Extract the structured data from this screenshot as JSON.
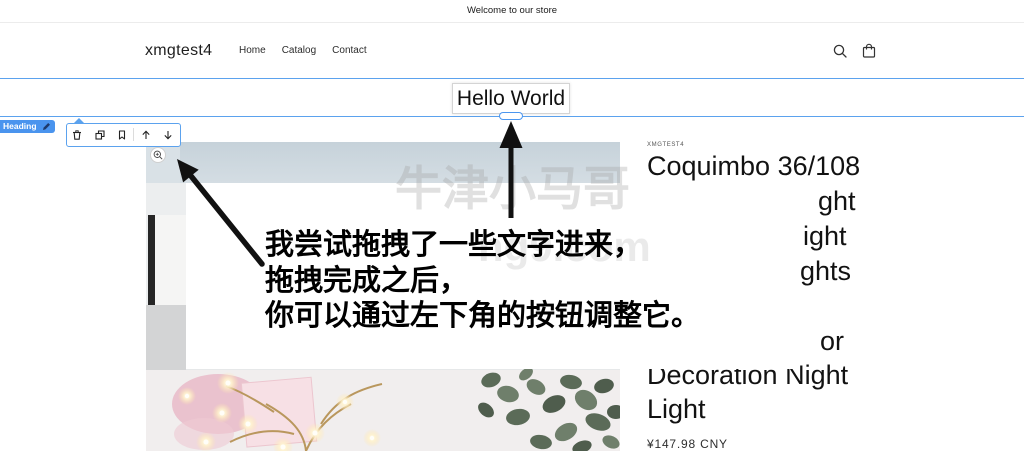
{
  "announcement": {
    "text": "Welcome to our store"
  },
  "header": {
    "logo": "xmgtest4",
    "nav": [
      {
        "label": "Home"
      },
      {
        "label": "Catalog"
      },
      {
        "label": "Contact"
      }
    ],
    "search_icon": "search-icon",
    "cart_icon": "cart-icon"
  },
  "editor": {
    "selected_heading_text": "Hello World",
    "element_type_badge": "Heading",
    "badge_icon": "pencil-icon",
    "toolbar_icons": [
      "trash-icon",
      "duplicate-icon",
      "bookmark-icon",
      "arrow-up-icon",
      "arrow-down-icon"
    ],
    "image_zoom_icon": "zoom-in-icon",
    "accent_color": "#4a94ee"
  },
  "product": {
    "vendor": "XMGTEST4",
    "title_visible_lines": [
      "Coquimbo 36/108",
      "ght",
      "ight",
      "ghts",
      "or",
      "Decoration Night",
      "Light"
    ],
    "price": "¥147.98 CNY"
  },
  "annotation": {
    "lines": [
      "我尝试拖拽了一些文字进来，",
      "拖拽完成之后，",
      "你可以通过左下角的按钮调整它。"
    ],
    "arrow_color": "#111111"
  },
  "watermark": {
    "name": "牛津小马哥",
    "site": "ng9.com"
  }
}
